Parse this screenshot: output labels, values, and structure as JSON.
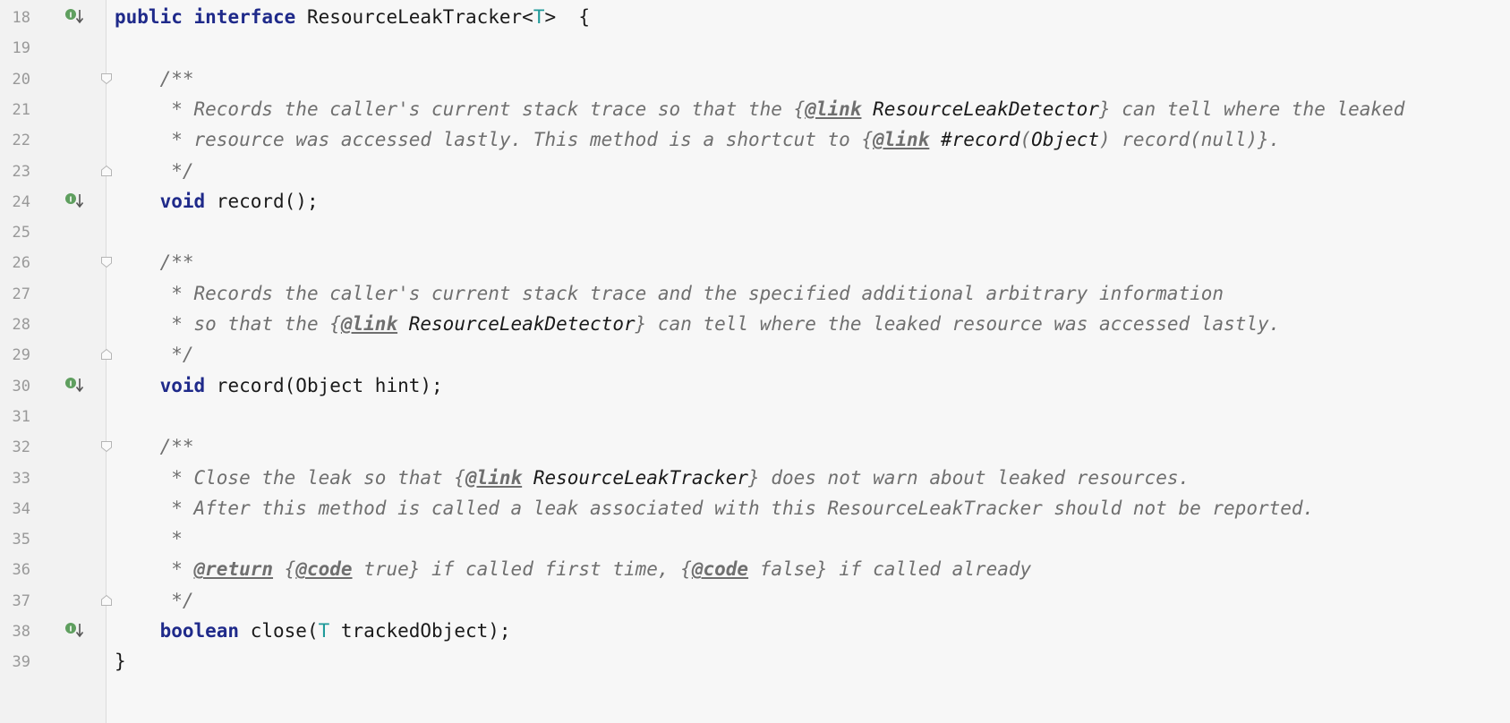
{
  "editor": {
    "lines": [
      {
        "n": "18",
        "segs": [
          [
            "kw",
            "public "
          ],
          [
            "kw",
            "interface "
          ],
          [
            "pl",
            "ResourceLeakTracker<"
          ],
          [
            "tp",
            "T"
          ],
          [
            "pl",
            ">  {"
          ]
        ]
      },
      {
        "n": "19",
        "segs": []
      },
      {
        "n": "20",
        "segs": [
          [
            "pl",
            "    "
          ],
          [
            "cm",
            "/**"
          ]
        ]
      },
      {
        "n": "21",
        "segs": [
          [
            "pl",
            "    "
          ],
          [
            "cm",
            " * Records the caller's current stack trace so that the {"
          ],
          [
            "tag",
            "@link"
          ],
          [
            "cm",
            " "
          ],
          [
            "ref",
            "ResourceLeakDetector"
          ],
          [
            "cm",
            "} can tell where the leaked"
          ]
        ]
      },
      {
        "n": "22",
        "segs": [
          [
            "pl",
            "    "
          ],
          [
            "cm",
            " * resource was accessed lastly. This method is a shortcut to {"
          ],
          [
            "tag",
            "@link"
          ],
          [
            "cm",
            " "
          ],
          [
            "ref",
            "#record"
          ],
          [
            "cm",
            "("
          ],
          [
            "ref",
            "Object"
          ],
          [
            "cm",
            ") record(null)}."
          ]
        ]
      },
      {
        "n": "23",
        "segs": [
          [
            "pl",
            "    "
          ],
          [
            "cm",
            " */"
          ]
        ]
      },
      {
        "n": "24",
        "segs": [
          [
            "pl",
            "    "
          ],
          [
            "kw",
            "void "
          ],
          [
            "pl",
            "record();"
          ]
        ]
      },
      {
        "n": "25",
        "segs": []
      },
      {
        "n": "26",
        "segs": [
          [
            "pl",
            "    "
          ],
          [
            "cm",
            "/**"
          ]
        ]
      },
      {
        "n": "27",
        "segs": [
          [
            "pl",
            "    "
          ],
          [
            "cm",
            " * Records the caller's current stack trace and the specified additional arbitrary information"
          ]
        ]
      },
      {
        "n": "28",
        "segs": [
          [
            "pl",
            "    "
          ],
          [
            "cm",
            " * so that the {"
          ],
          [
            "tag",
            "@link"
          ],
          [
            "cm",
            " "
          ],
          [
            "ref",
            "ResourceLeakDetector"
          ],
          [
            "cm",
            "} can tell where the leaked resource was accessed lastly."
          ]
        ]
      },
      {
        "n": "29",
        "segs": [
          [
            "pl",
            "    "
          ],
          [
            "cm",
            " */"
          ]
        ]
      },
      {
        "n": "30",
        "segs": [
          [
            "pl",
            "    "
          ],
          [
            "kw",
            "void "
          ],
          [
            "pl",
            "record(Object hint);"
          ]
        ]
      },
      {
        "n": "31",
        "segs": []
      },
      {
        "n": "32",
        "segs": [
          [
            "pl",
            "    "
          ],
          [
            "cm",
            "/**"
          ]
        ]
      },
      {
        "n": "33",
        "segs": [
          [
            "pl",
            "    "
          ],
          [
            "cm",
            " * Close the leak so that {"
          ],
          [
            "tag",
            "@link"
          ],
          [
            "cm",
            " "
          ],
          [
            "ref",
            "ResourceLeakTracker"
          ],
          [
            "cm",
            "} does not warn about leaked resources."
          ]
        ]
      },
      {
        "n": "34",
        "segs": [
          [
            "pl",
            "    "
          ],
          [
            "cm",
            " * After this method is called a leak associated with this ResourceLeakTracker should not be reported."
          ]
        ]
      },
      {
        "n": "35",
        "segs": [
          [
            "pl",
            "    "
          ],
          [
            "cm",
            " *"
          ]
        ]
      },
      {
        "n": "36",
        "segs": [
          [
            "pl",
            "    "
          ],
          [
            "cm",
            " * "
          ],
          [
            "tag",
            "@return"
          ],
          [
            "cm",
            " {"
          ],
          [
            "tag",
            "@code"
          ],
          [
            "cm",
            " true} if called first time, {"
          ],
          [
            "tag",
            "@code"
          ],
          [
            "cm",
            " false} if called already"
          ]
        ]
      },
      {
        "n": "37",
        "segs": [
          [
            "pl",
            "    "
          ],
          [
            "cm",
            " */"
          ]
        ]
      },
      {
        "n": "38",
        "segs": [
          [
            "pl",
            "    "
          ],
          [
            "kw",
            "boolean "
          ],
          [
            "pl",
            "close("
          ],
          [
            "tp",
            "T"
          ],
          [
            "pl",
            " trackedObject);"
          ]
        ]
      },
      {
        "n": "39",
        "segs": [
          [
            "pl",
            "}"
          ]
        ]
      }
    ],
    "impl_icon_lines": [
      "18",
      "24",
      "30",
      "38"
    ],
    "fold_start_lines": [
      "20",
      "26",
      "32"
    ],
    "fold_end_lines": [
      "23",
      "29",
      "37"
    ],
    "icons": {
      "implementation": "implementation-down-arrow-icon",
      "fold": "fold-marker-icon"
    },
    "colors": {
      "keyword": "#1f2a8a",
      "type_param": "#1f9a9a",
      "comment": "#6f6f6f",
      "background": "#f7f7f7"
    }
  }
}
